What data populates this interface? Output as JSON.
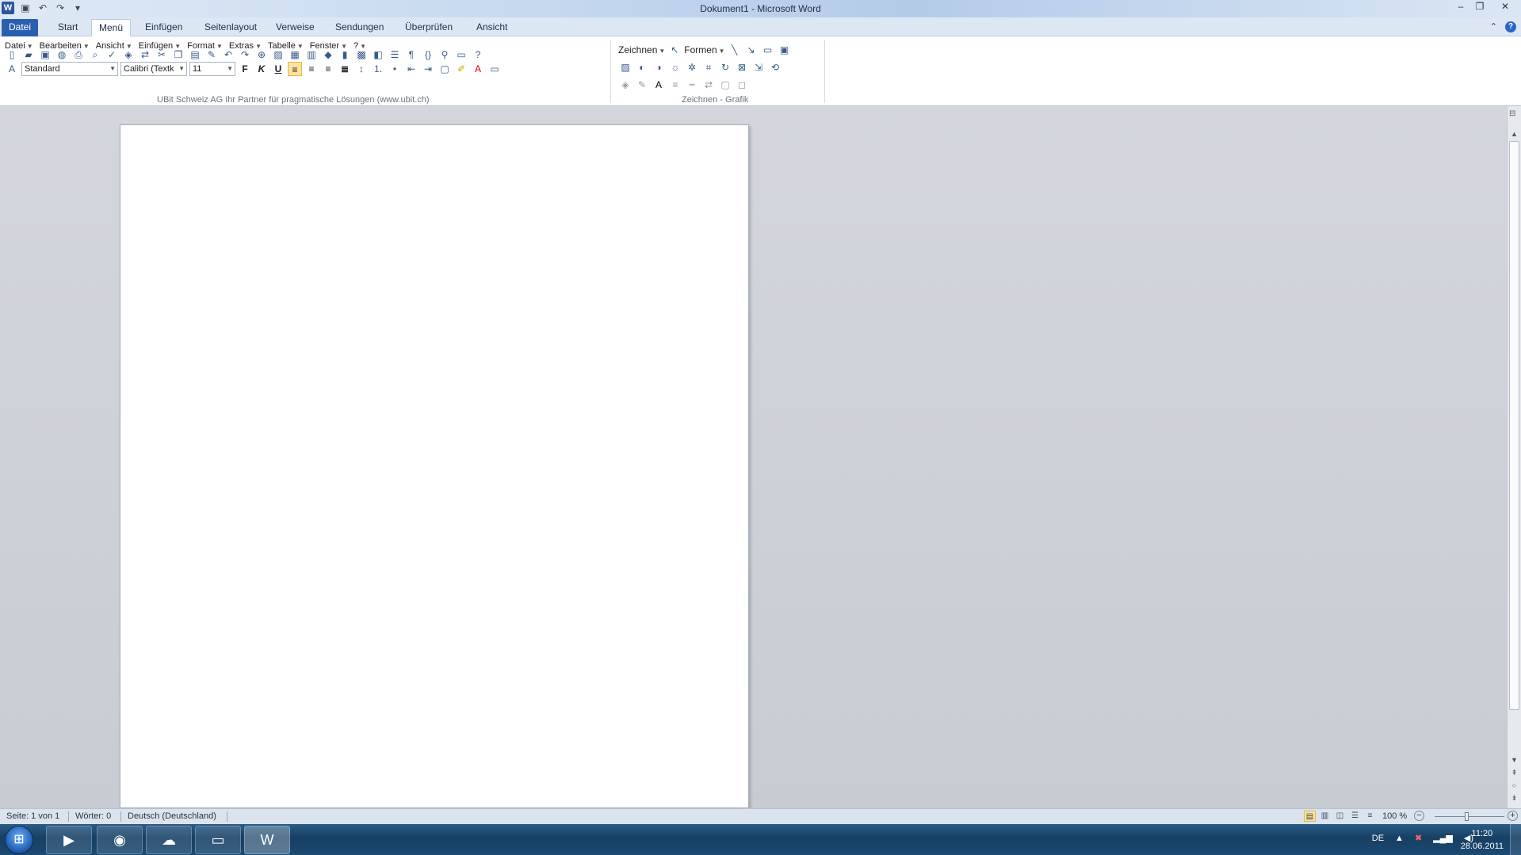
{
  "window": {
    "title": "Dokument1  -  Microsoft Word",
    "app_icon": "W"
  },
  "ribbon_tabs": [
    {
      "label": "Datei"
    },
    {
      "label": "Start"
    },
    {
      "label": "Menü"
    },
    {
      "label": "Einfügen"
    },
    {
      "label": "Seitenlayout"
    },
    {
      "label": "Verweise"
    },
    {
      "label": "Sendungen"
    },
    {
      "label": "Überprüfen"
    },
    {
      "label": "Ansicht"
    }
  ],
  "menus": [
    {
      "label": "Datei"
    },
    {
      "label": "Bearbeiten"
    },
    {
      "label": "Ansicht"
    },
    {
      "label": "Einfügen"
    },
    {
      "label": "Format"
    },
    {
      "label": "Extras"
    },
    {
      "label": "Tabelle"
    },
    {
      "label": "Fenster"
    },
    {
      "label": "?"
    }
  ],
  "formatting": {
    "style": "Standard",
    "font": "Calibri (Textk",
    "size": "11",
    "bold": "F",
    "italic": "K",
    "underline": "U"
  },
  "group_labels": {
    "menu_group": "UBit Schweiz AG    Ihr Partner für pragmatische Lösungen    (www.ubit.ch)",
    "drawing_group": "Zeichnen - Grafik"
  },
  "drawing": {
    "zeichnen": "Zeichnen",
    "formen": "Formen"
  },
  "statusbar": {
    "page": "Seite: 1 von 1",
    "words": "Wörter: 0",
    "language": "Deutsch (Deutschland)",
    "zoom": "100 %"
  },
  "taskbar": {
    "language": "DE",
    "time": "11:20",
    "date": "28.06.2011"
  },
  "colors": {
    "ribbon_accent": "#2a5fae",
    "selected_button": "#fde29b",
    "taskbar": "#1b4a73"
  }
}
